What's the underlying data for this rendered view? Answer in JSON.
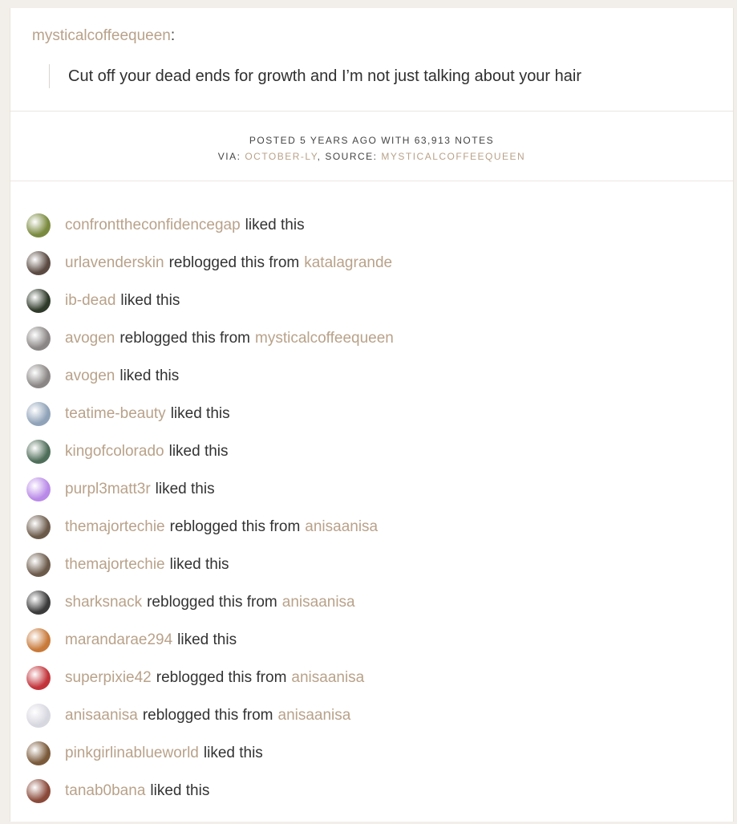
{
  "post": {
    "author": "mysticalcoffeequeen",
    "author_colon": ":",
    "quote": "Cut off your dead ends for growth and I’m not just talking about your hair"
  },
  "meta": {
    "posted": "POSTED 5 YEARS AGO WITH 63,913 NOTES",
    "via_label": "VIA:",
    "via_link": "OCTOBER-LY",
    "source_label": ", SOURCE:",
    "source_link": "MYSTICALCOFFEEQUEEN"
  },
  "notes": [
    {
      "user": "confronttheconfidencegap",
      "action": "liked this",
      "from": "",
      "avatar_color": "#7a8a3e"
    },
    {
      "user": "urlavenderskin",
      "action": "reblogged this from",
      "from": "katalagrande",
      "avatar_color": "#5a4a42"
    },
    {
      "user": "ib-dead",
      "action": "liked this",
      "from": "",
      "avatar_color": "#2f3a2a"
    },
    {
      "user": "avogen",
      "action": "reblogged this from",
      "from": "mysticalcoffeequeen",
      "avatar_color": "#8a8685"
    },
    {
      "user": "avogen",
      "action": "liked this",
      "from": "",
      "avatar_color": "#8a8685"
    },
    {
      "user": "teatime-beauty",
      "action": "liked this",
      "from": "",
      "avatar_color": "#8fa2b8"
    },
    {
      "user": "kingofcolorado",
      "action": "liked this",
      "from": "",
      "avatar_color": "#4f6e5a"
    },
    {
      "user": "purpl3matt3r",
      "action": "liked this",
      "from": "",
      "avatar_color": "#b98ae8"
    },
    {
      "user": "themajortechie",
      "action": "reblogged this from",
      "from": "anisaanisa",
      "avatar_color": "#6b5a4a"
    },
    {
      "user": "themajortechie",
      "action": "liked this",
      "from": "",
      "avatar_color": "#6b5a4a"
    },
    {
      "user": "sharksnack",
      "action": "reblogged this from",
      "from": "anisaanisa",
      "avatar_color": "#3b3b3b"
    },
    {
      "user": "marandarae294",
      "action": "liked this",
      "from": "",
      "avatar_color": "#c87a3a"
    },
    {
      "user": "superpixie42",
      "action": "reblogged this from",
      "from": "anisaanisa",
      "avatar_color": "#c2343a"
    },
    {
      "user": "anisaanisa",
      "action": "reblogged this from",
      "from": "anisaanisa",
      "avatar_color": "#d7d7e0"
    },
    {
      "user": "pinkgirlinablueworld",
      "action": "liked this",
      "from": "",
      "avatar_color": "#7a5a3a"
    },
    {
      "user": "tanab0bana",
      "action": "liked this",
      "from": "",
      "avatar_color": "#8a4a3a"
    }
  ]
}
